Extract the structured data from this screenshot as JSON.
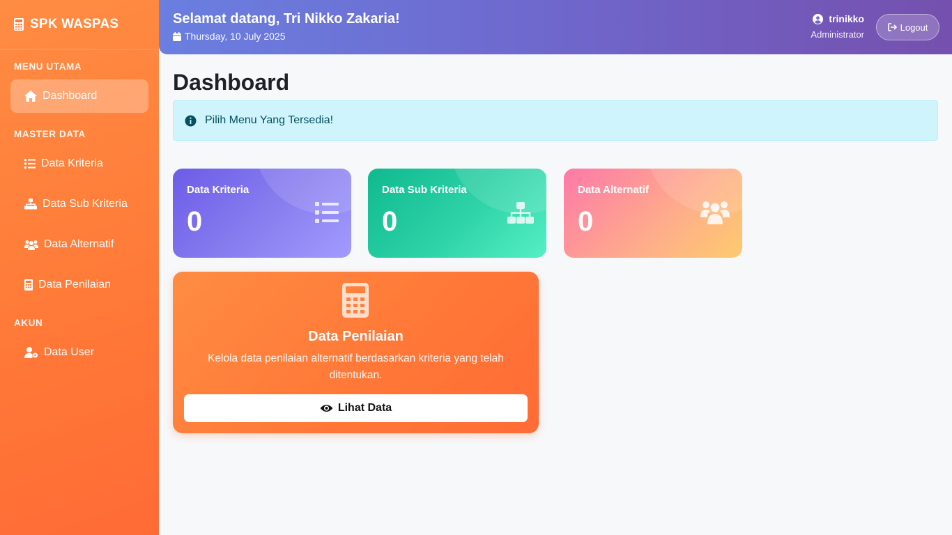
{
  "brand": {
    "title": "SPK WASPAS",
    "icon": "calculator-icon"
  },
  "sidebar": {
    "sections": {
      "menu_utama": "MENU UTAMA",
      "master_data": "MASTER DATA",
      "akun": "AKUN"
    },
    "items": [
      {
        "label": "Dashboard",
        "icon": "home-icon",
        "active": true
      },
      {
        "label": "Data Kriteria",
        "icon": "list-icon",
        "active": false
      },
      {
        "label": "Data Sub Kriteria",
        "icon": "sitemap-icon",
        "active": false
      },
      {
        "label": "Data Alternatif",
        "icon": "users-icon",
        "active": false
      },
      {
        "label": "Data Penilaian",
        "icon": "calculator-icon",
        "active": false
      },
      {
        "label": "Data User",
        "icon": "user-cog-icon",
        "active": false
      }
    ]
  },
  "header": {
    "welcome": "Selamat datang, Tri Nikko Zakaria!",
    "date": "Thursday, 10 July 2025",
    "username": "trinikko",
    "role": "Administrator",
    "logout_label": "Logout"
  },
  "main": {
    "title": "Dashboard",
    "alert": "Pilih Menu Yang Tersedia!",
    "stats": [
      {
        "label": "Data Kriteria",
        "value": "0",
        "icon": "list-icon"
      },
      {
        "label": "Data Sub Kriteria",
        "value": "0",
        "icon": "sitemap-icon"
      },
      {
        "label": "Data Alternatif",
        "value": "0",
        "icon": "users-icon"
      }
    ],
    "penilaian_card": {
      "title": "Data Penilaian",
      "description": "Kelola data penilaian alternatif berdasarkan kriteria yang telah ditentukan.",
      "button_label": "Lihat Data",
      "icon": "calculator-icon"
    }
  },
  "colors": {
    "sidebar": "#ff7a38",
    "header_start": "#6a7fe0",
    "header_end": "#7550ae",
    "card_kriteria": "#6c5ce7",
    "card_sub_kriteria": "#0fb98e",
    "card_alternatif": "#fd79a8",
    "card_penilaian": "#ff7a38",
    "alert_bg": "#cff4fc"
  }
}
